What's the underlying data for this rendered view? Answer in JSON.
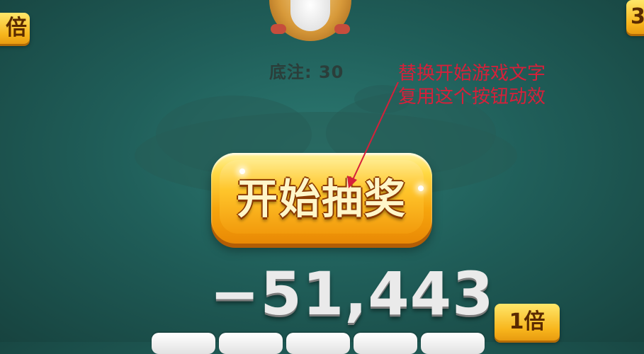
{
  "badges": {
    "left": "倍",
    "right": "3",
    "bottom": "1倍"
  },
  "table": {
    "ante_label": "底注: 30"
  },
  "annotation": {
    "line1": "替换开始游戏文字",
    "line2": "复用这个按钮动效"
  },
  "main": {
    "lottery_button_label": "开始抽奖",
    "score": "−51,443"
  },
  "colors": {
    "background": "#205f5a",
    "button_gold": "#ffc62c",
    "annotation_red": "#d6203a"
  }
}
